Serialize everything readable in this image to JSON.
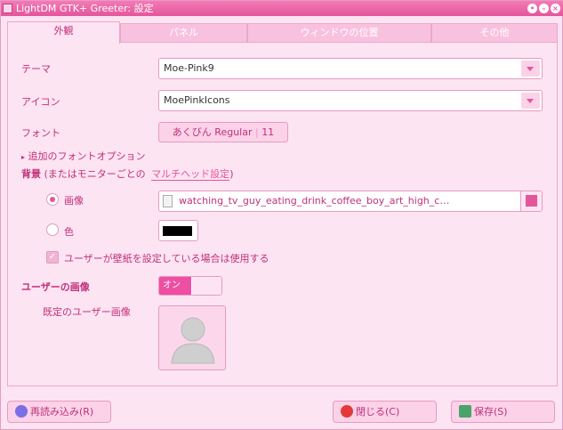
{
  "window": {
    "title": "LightDM GTK+ Greeter: 設定",
    "controls": [
      "pin",
      "minimize",
      "close"
    ]
  },
  "tabs": [
    {
      "label": "外観",
      "active": true
    },
    {
      "label": "パネル",
      "active": false
    },
    {
      "label": "ウィンドウの位置",
      "active": false
    },
    {
      "label": "その他",
      "active": false
    }
  ],
  "appearance": {
    "theme_label": "テーマ",
    "theme_value": "Moe-Pink9",
    "icon_label": "アイコン",
    "icon_value": "MoePinkIcons",
    "font_label": "フォント",
    "font_value": "あくびん Regular",
    "font_size": "11",
    "font_options_expander": "追加のフォントオプション",
    "background_label": "背景",
    "background_note_prefix": "(またはモニターごとの",
    "background_link": "マルチヘッド設定",
    "background_note_suffix": ")",
    "image_radio": "画像",
    "image_file": "watching_tv_guy_eating_drink_coffee_boy_art_high_c…",
    "color_radio": "色",
    "color_value": "#000000",
    "user_wallpaper_check": "ユーザーが壁紙を設定している場合は使用する",
    "user_image_label": "ユーザーの画像",
    "user_image_toggle": "オン",
    "default_user_image_label": "既定のユーザー画像"
  },
  "footer": {
    "reload": "再読み込み(R)",
    "close": "閉じる(C)",
    "save": "保存(S)"
  },
  "colors": {
    "accent": "#e4559b",
    "background": "#fde4f2"
  }
}
